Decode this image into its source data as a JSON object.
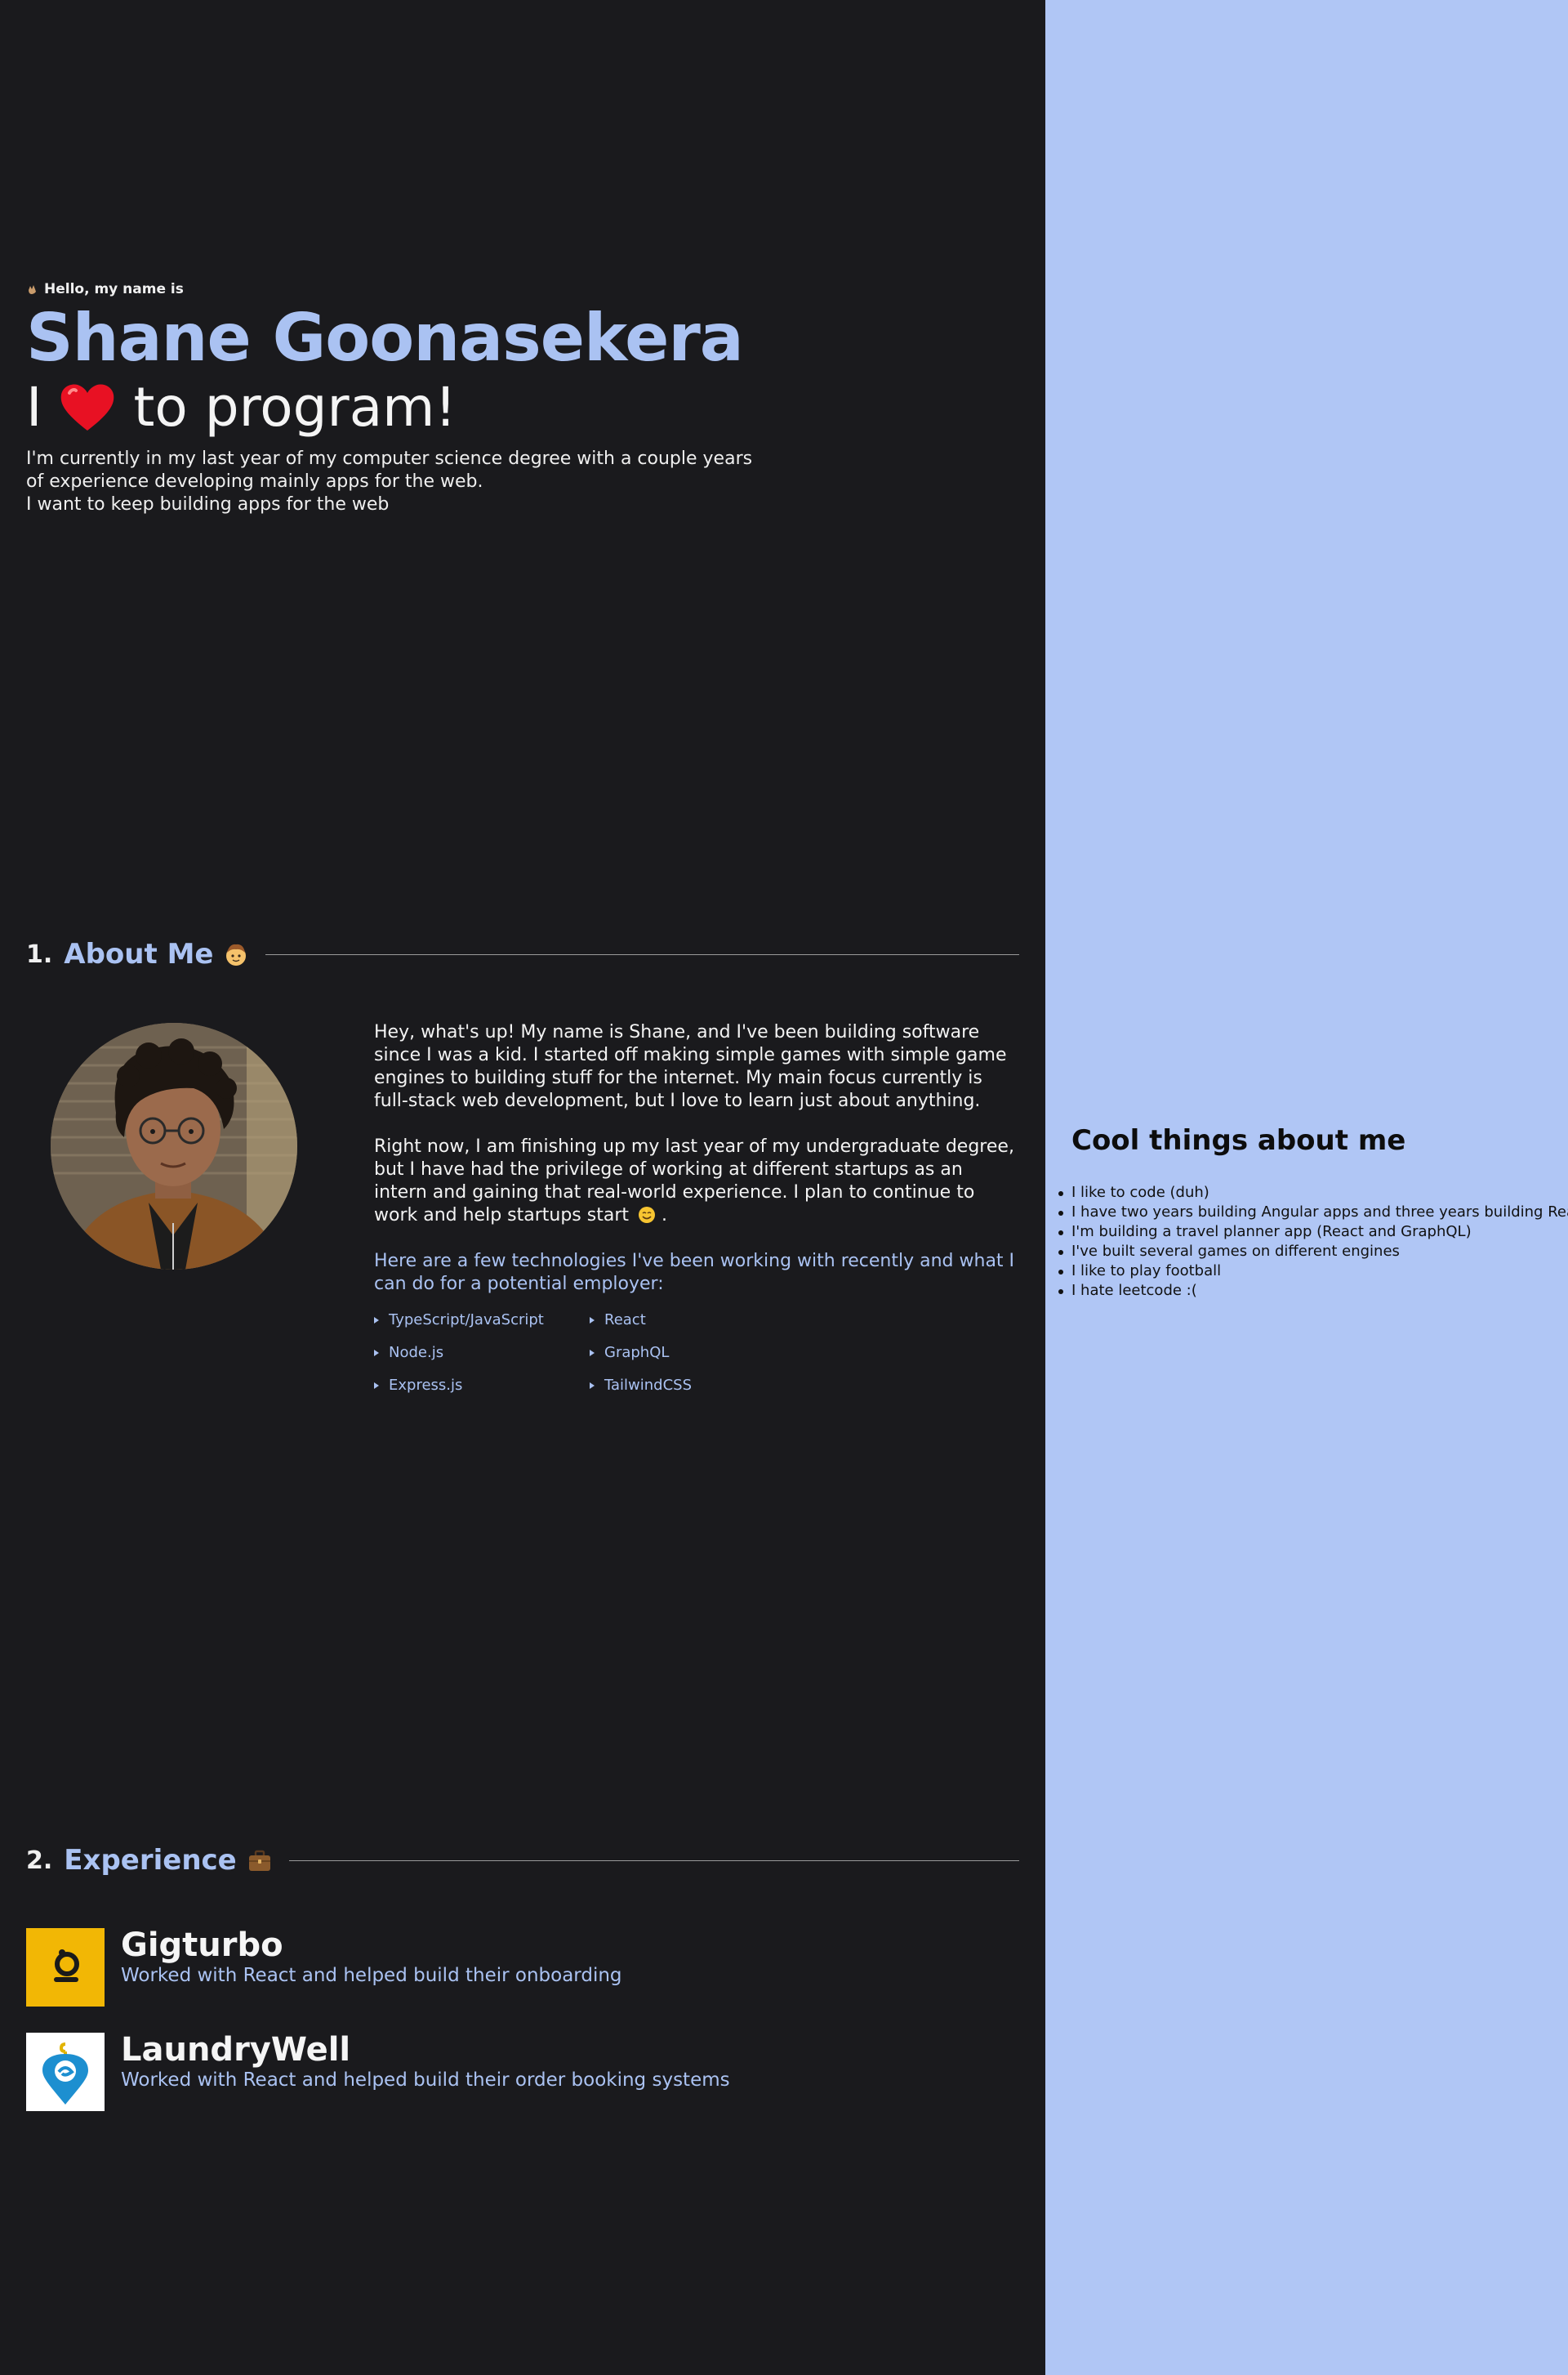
{
  "hero": {
    "greeting": "Hello, my name is",
    "name": "Shane Goonasekera",
    "love_prefix": "I",
    "love_suffix": "to program!",
    "intro_lines": [
      "I'm currently in my last year of my computer science degree with a couple years",
      "of experience developing mainly apps for the web.",
      "I want to keep building apps for the web"
    ]
  },
  "about": {
    "number": "1.",
    "title": "About Me",
    "paragraph1": "Hey, what's up! My name is Shane, and I've been building software since I was a kid. I started off making simple games with simple game engines to building stuff for the internet. My main focus currently is full-stack web development, but I love to learn just about anything.",
    "paragraph2": "Right now, I am finishing up my last year of my undergraduate degree, but I have had the privilege of working at different startups as an intern and gaining that real-world experience. I plan to continue to work and help startups start",
    "paragraph2_end": ".",
    "tech_intro": "Here are a few technologies I've been working with recently and what I can do for a potential employer:",
    "technologies": [
      "TypeScript/JavaScript",
      "React",
      "Node.js",
      "GraphQL",
      "Express.js",
      "TailwindCSS"
    ]
  },
  "experience": {
    "number": "2.",
    "title": "Experience",
    "jobs": [
      {
        "name": "Gigturbo",
        "description": "Worked with React and helped build their onboarding"
      },
      {
        "name": "LaundryWell",
        "description": "Worked with React and helped build their order booking systems"
      }
    ]
  },
  "sidebar": {
    "title": "Cool things about me",
    "items": [
      "I like to code (duh)",
      "I have two years building Angular apps and three years building React apps",
      "I'm building a travel planner app (React and GraphQL)",
      "I've built several games on different engines",
      "I like to play football",
      "I hate leetcode :("
    ]
  },
  "colors": {
    "background": "#1a1a1d",
    "accent": "#aac2f2",
    "sidebar_bg": "#b0c6f5",
    "gigturbo_brand": "#f2b705",
    "laundrywell_brand": "#1d8fd0"
  }
}
